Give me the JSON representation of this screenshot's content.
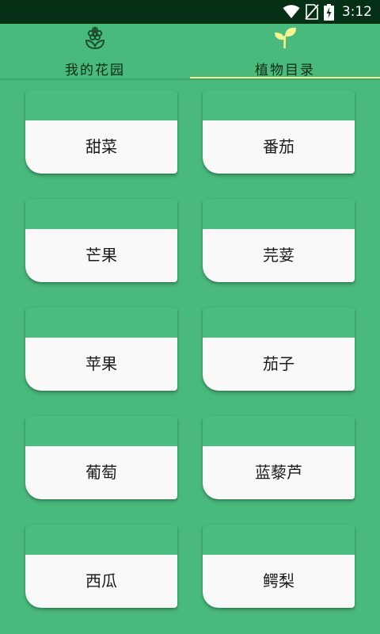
{
  "status_bar": {
    "time": "3:12",
    "icons": [
      "wifi-icon",
      "no-sim-icon",
      "battery-charging-icon"
    ]
  },
  "tabs": [
    {
      "label": "我的花园",
      "icon": "flower-outline-icon",
      "selected": false
    },
    {
      "label": "植物目录",
      "icon": "sprout-icon",
      "selected": true
    }
  ],
  "plants": [
    {
      "name": "甜菜"
    },
    {
      "name": "番茄"
    },
    {
      "name": "芒果"
    },
    {
      "name": "芫荽"
    },
    {
      "name": "苹果"
    },
    {
      "name": "茄子"
    },
    {
      "name": "葡萄"
    },
    {
      "name": "蓝藜芦"
    },
    {
      "name": "西瓜"
    },
    {
      "name": "鳄梨"
    }
  ],
  "colors": {
    "background": "#49b97c",
    "status_bar": "#063016",
    "tab_indicator": "#f3f592",
    "card_face": "#f9f9f9",
    "sprout_icon": "#f3f592",
    "flower_icon": "#1b4d2c"
  }
}
